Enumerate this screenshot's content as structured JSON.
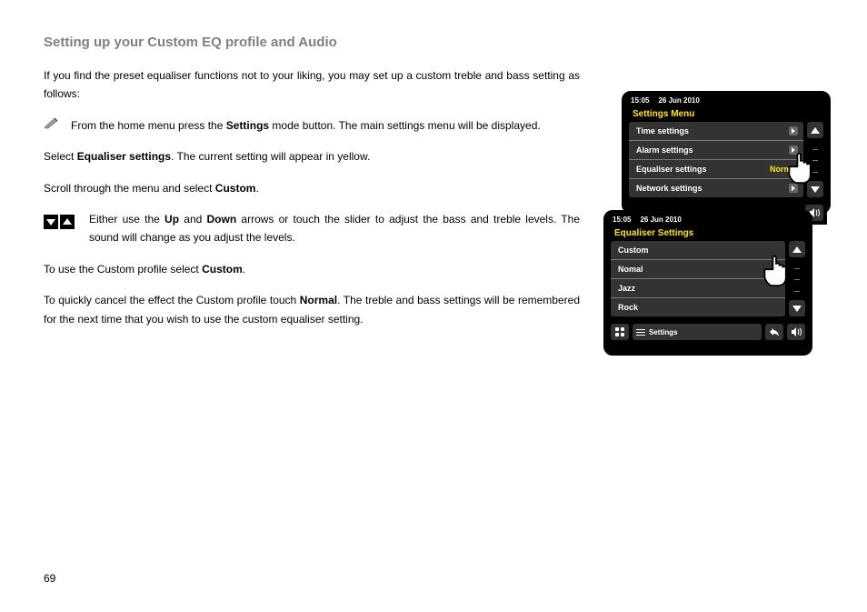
{
  "title": "Setting up your Custom EQ profile and Audio",
  "intro": "If you find the preset equaliser functions not to your liking, you may set up a custom treble and bass setting as follows:",
  "step_settings_a": "From the home menu press the ",
  "step_settings_b": "Settings",
  "step_settings_c": " mode button. The main settings menu will be displayed.",
  "select_eq_a": "Select ",
  "select_eq_b": "Equaliser settings",
  "select_eq_c": ". The current setting will appear in yellow.",
  "scroll_a": "Scroll through the menu and select ",
  "scroll_b": "Custom",
  "scroll_c": ".",
  "arrows_a": "Either use the ",
  "arrows_b": "Up",
  "arrows_c": " and ",
  "arrows_d": "Down",
  "arrows_e": " arrows or touch the slider to adjust the bass and treble levels. The sound will change as you adjust the levels.",
  "use_custom_a": "To use the Custom profile select ",
  "use_custom_b": "Custom",
  "use_custom_c": ".",
  "cancel_a": "To quickly cancel the effect the Custom profile touch ",
  "cancel_b": "Normal",
  "cancel_c": ". The treble and bass settings will be remembered for the next time that you wish to use the custom equaliser setting.",
  "page_number": "69",
  "screens": {
    "top": {
      "time": "15:05",
      "date": "26 Jun 2010",
      "header": "Settings Menu",
      "rows": {
        "r1": "Time settings",
        "r2": "Alarm settings",
        "r3": "Equaliser settings",
        "r3_accent": "Normal",
        "r4": "Network settings"
      }
    },
    "bottom": {
      "time": "15:05",
      "date": "26 Jun 2010",
      "header": "Equaliser Settings",
      "rows": {
        "r1": "Custom",
        "r2": "Nomal",
        "r3": "Jazz",
        "r4": "Rock"
      },
      "footer_label": "Settings"
    }
  }
}
